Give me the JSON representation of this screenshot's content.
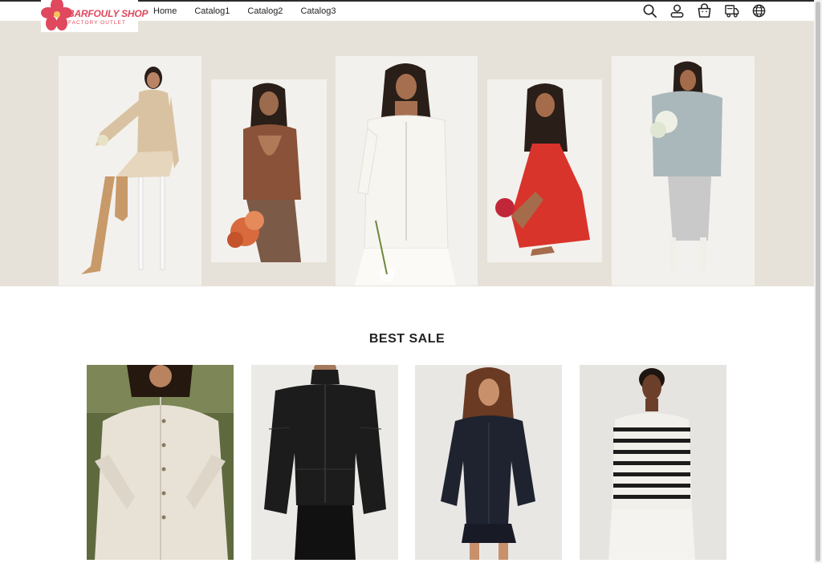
{
  "brand": {
    "name": "BARFOULY SHOP",
    "tagline": "FACTORY OUTLET",
    "color": "#e0485e"
  },
  "nav": {
    "items": [
      {
        "label": "Home"
      },
      {
        "label": "Catalog1"
      },
      {
        "label": "Catalog2"
      },
      {
        "label": "Catalog3"
      }
    ]
  },
  "header_icons": [
    "search-icon",
    "account-icon",
    "shopping-bag-icon",
    "shipping-truck-icon",
    "language-globe-icon"
  ],
  "hero": {
    "background": "#e7e2d9",
    "models": [
      {
        "outfit": "beige knit set",
        "color": "#d9c2a2"
      },
      {
        "outfit": "brown open-back top",
        "color": "#8a5238"
      },
      {
        "outfit": "white off-shoulder suit",
        "color": "#f4f2ee"
      },
      {
        "outfit": "red dress",
        "color": "#d9342b"
      },
      {
        "outfit": "grey faux fur coat",
        "color": "#aab8bc"
      }
    ]
  },
  "best_sale": {
    "title": "BEST SALE",
    "products": [
      {
        "item": "cream button cardigan",
        "color": "#e8e2d6"
      },
      {
        "item": "black puffer jacket",
        "color": "#1c1c1c"
      },
      {
        "item": "navy shirt romper",
        "color": "#1f2330"
      },
      {
        "item": "striped long sleeve top",
        "color": "#f2f0ea"
      }
    ]
  }
}
